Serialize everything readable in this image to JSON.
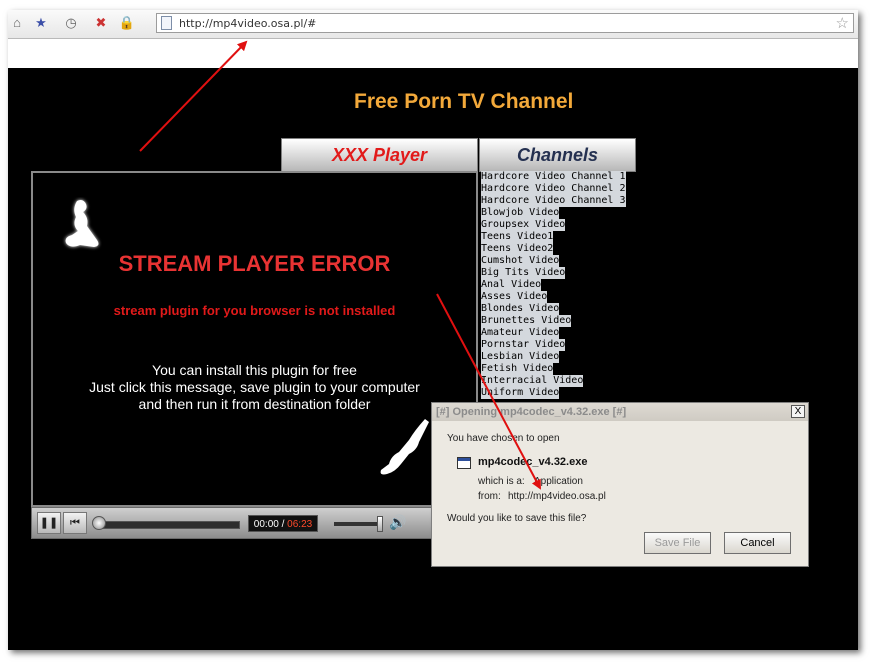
{
  "browser": {
    "url": "http://mp4video.osa.pl/#",
    "toolbar_icons": [
      "home-icon",
      "bookmark-icon",
      "history-icon",
      "stop-icon",
      "lock-icon"
    ]
  },
  "site": {
    "title": "Free Porn TV Channel",
    "tabs": [
      {
        "label": "XXX Player"
      },
      {
        "label": "Channels"
      }
    ]
  },
  "player": {
    "error_title": "STREAM PLAYER ERROR",
    "error_subtitle": "stream plugin for you browser is not installed",
    "message_lines": [
      "You can install this plugin for free",
      "Just click this message, save plugin to your computer",
      "and then run it from destination folder"
    ],
    "time_current": "00:00",
    "time_separator": " / ",
    "time_total": "06:23"
  },
  "channels": [
    "Hardcore Video Channel 1",
    "Hardcore Video Channel 2",
    "Hardcore Video Channel 3",
    "Blowjob Video",
    "Groupsex Video",
    "Teens Video1",
    "Teens Video2",
    "Cumshot Video",
    "Big Tits Video",
    "Anal Video",
    "Asses Video",
    "Blondes Video",
    "Brunettes Video",
    "Amateur Video",
    "Pornstar Video",
    "Lesbian Video",
    "Fetish Video",
    "Interracial Video",
    "Uniform Video"
  ],
  "dialog": {
    "title": "[#] Opening mp4codec_v4.32.exe [#]",
    "close_label": "X",
    "intro": "You have chosen to open",
    "filename": "mp4codec_v4.32.exe",
    "which_is_label": "which is a:",
    "which_is_value": "Application",
    "from_label": "from:",
    "from_value": "http://mp4video.osa.pl",
    "question": "Would you like to save this file?",
    "save_label": "Save File",
    "cancel_label": "Cancel"
  },
  "colors": {
    "title_orange": "#f3a93a",
    "error_red": "#e83333",
    "arrow_red": "#e01010"
  }
}
